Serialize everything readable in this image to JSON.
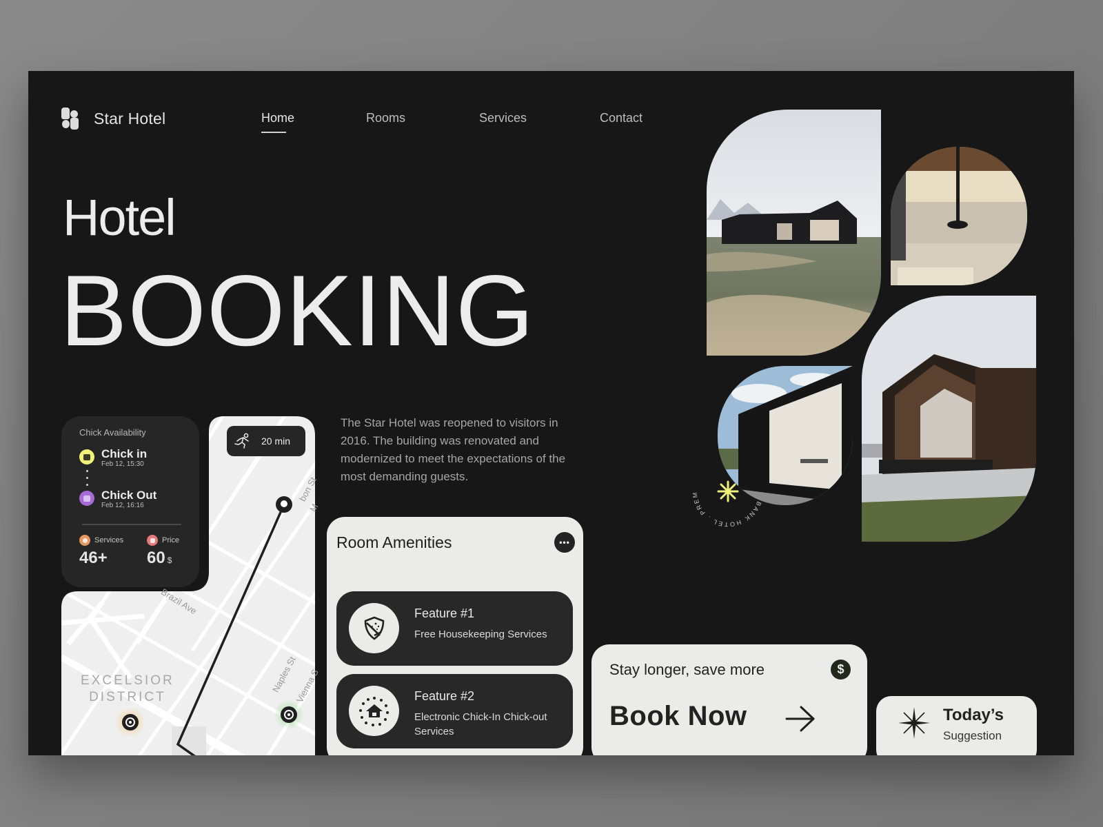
{
  "brand": {
    "name": "Star Hotel",
    "logo_icon": "four-blob-logo-icon"
  },
  "nav": {
    "items": [
      {
        "label": "Home",
        "active": true
      },
      {
        "label": "Rooms",
        "active": false
      },
      {
        "label": "Services",
        "active": false
      },
      {
        "label": "Contact",
        "active": false
      }
    ]
  },
  "hero": {
    "line1": "Hotel",
    "line2": "BOOKING"
  },
  "availability": {
    "title": "Chick Availability",
    "check_in": {
      "label": "Chick in",
      "date": "Feb 12, 15:30",
      "icon": "calendar-icon",
      "color": "#f2f27a"
    },
    "check_out": {
      "label": "Chick Out",
      "date": "Feb 12, 16:16",
      "icon": "calendar-icon",
      "color": "#a56ad8"
    },
    "services": {
      "label": "Services",
      "value": "46+",
      "icon": "clock-icon",
      "color": "#e59761"
    },
    "price": {
      "label": "Price",
      "value": "60",
      "unit": "$",
      "icon": "wallet-icon",
      "color": "#e67a7a"
    }
  },
  "map": {
    "walk_time": "20 min",
    "walk_icon": "running-person-icon",
    "streets": [
      "bon St",
      "M",
      "Brazil Ave",
      "Naples St",
      "Vienna S"
    ],
    "district_line1": "EXCELSIOR",
    "district_line2": "DISTRICT"
  },
  "description": "The Star Hotel was reopened to visitors in 2016. The building was renovated and modernized to meet the expectations of the most demanding guests.",
  "amenities": {
    "title": "Room Amenities",
    "more_icon": "more-horizontal-icon",
    "features": [
      {
        "name": "Feature #1",
        "desc": "Free Housekeeping Services",
        "icon": "shield-sparkle-icon"
      },
      {
        "name": "Feature #2",
        "desc": "Electronic Chick-In Chick-out Services",
        "icon": "house-services-icon"
      }
    ]
  },
  "badge": {
    "text": "BANK HOTEL . PREMIUM ROOMS .",
    "accent": "#eef07a"
  },
  "gallery": [
    "exterior-meadow-cabin",
    "interior-fireplace-lake",
    "cabin-glass-wall",
    "cabin-wood-gable"
  ],
  "promo": {
    "subtitle": "Stay longer, save more",
    "cta": "Book Now",
    "currency_symbol": "$"
  },
  "suggestion": {
    "title": "Today’s",
    "subtitle": "Suggestion"
  }
}
